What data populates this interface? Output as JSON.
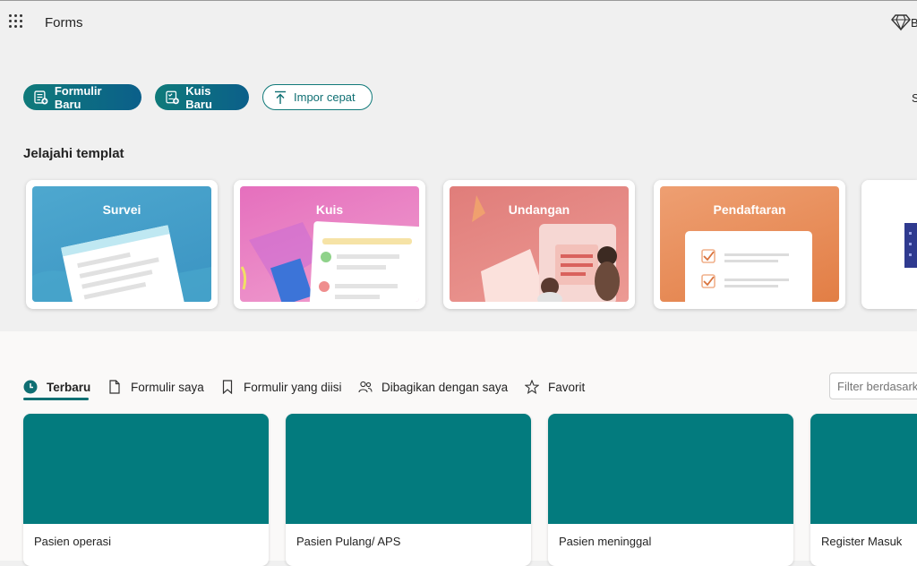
{
  "app": {
    "title": "Forms",
    "premium_label": "B"
  },
  "actions": {
    "new_form": "Formulir Baru",
    "new_quiz": "Kuis Baru",
    "quick_import": "Impor cepat",
    "right_cut": "S"
  },
  "templates": {
    "title": "Jelajahi templat",
    "items": [
      {
        "label": "Survei"
      },
      {
        "label": "Kuis"
      },
      {
        "label": "Undangan"
      },
      {
        "label": "Pendaftaran"
      }
    ]
  },
  "tabs": [
    {
      "label": "Terbaru",
      "icon": "clock-icon"
    },
    {
      "label": "Formulir saya",
      "icon": "document-icon"
    },
    {
      "label": "Formulir yang diisi",
      "icon": "bookmark-icon"
    },
    {
      "label": "Dibagikan dengan saya",
      "icon": "people-icon"
    },
    {
      "label": "Favorit",
      "icon": "star-icon"
    }
  ],
  "filter": {
    "placeholder": "Filter berdasarkan"
  },
  "forms": [
    {
      "name": "Pasien operasi"
    },
    {
      "name": "Pasien Pulang/ APS"
    },
    {
      "name": "Pasien meninggal"
    },
    {
      "name": "Register Masuk"
    }
  ],
  "colors": {
    "accent": "#037b7e",
    "button_gradient_end": "#0b5f8a"
  }
}
